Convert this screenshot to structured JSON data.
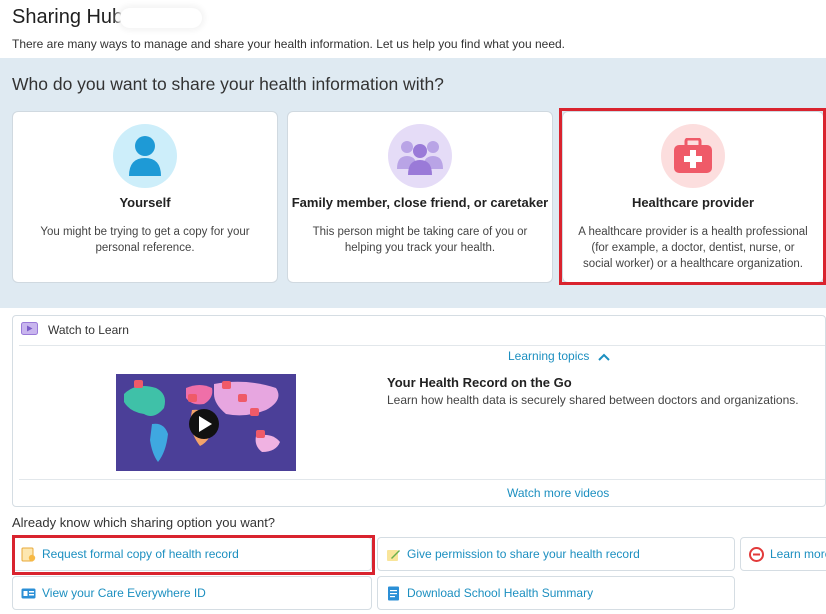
{
  "header": {
    "title": "Sharing Hub",
    "subtitle": "There are many ways to manage and share your health information. Let us help you find what you need."
  },
  "share_section": {
    "question": "Who do you want to share your health information with?",
    "cards": [
      {
        "title": "Yourself",
        "description": "You might be trying to get a copy for your personal reference.",
        "icon": "person-icon",
        "icon_bg": "#cdeefa",
        "icon_color": "#1e9ad6"
      },
      {
        "title": "Family member, close friend, or caretaker",
        "description": "This person might be taking care of you or helping you track your health.",
        "icon": "group-icon",
        "icon_bg": "#e5dcf7",
        "icon_color": "#9a7ad8"
      },
      {
        "title": "Healthcare provider",
        "description": "A healthcare provider is a health professional (for example, a doctor, dentist, nurse, or social worker) or a healthcare organization.",
        "icon": "medical-bag-icon",
        "icon_bg": "#fcdede",
        "icon_color": "#ef5a68"
      }
    ]
  },
  "watch": {
    "heading": "Watch to Learn",
    "topics_link": "Learning topics",
    "video_title": "Your Health Record on the Go",
    "video_description": "Learn how health data is securely shared between doctors and organizations.",
    "more_link": "Watch more videos"
  },
  "options": {
    "heading": "Already know which sharing option you want?",
    "items": [
      {
        "label": "Request formal copy of health record",
        "icon": "document-icon"
      },
      {
        "label": "Give permission to share your health record",
        "icon": "pencil-icon"
      },
      {
        "label": "Learn more",
        "icon": "care-everywhere-icon"
      },
      {
        "label": "View your Care Everywhere ID",
        "icon": "id-card-icon"
      },
      {
        "label": "Download School Health Summary",
        "icon": "download-doc-icon"
      }
    ]
  },
  "colors": {
    "accent": "#1c8fc0",
    "highlight": "#d9232e",
    "band": "#dfeaf2"
  }
}
